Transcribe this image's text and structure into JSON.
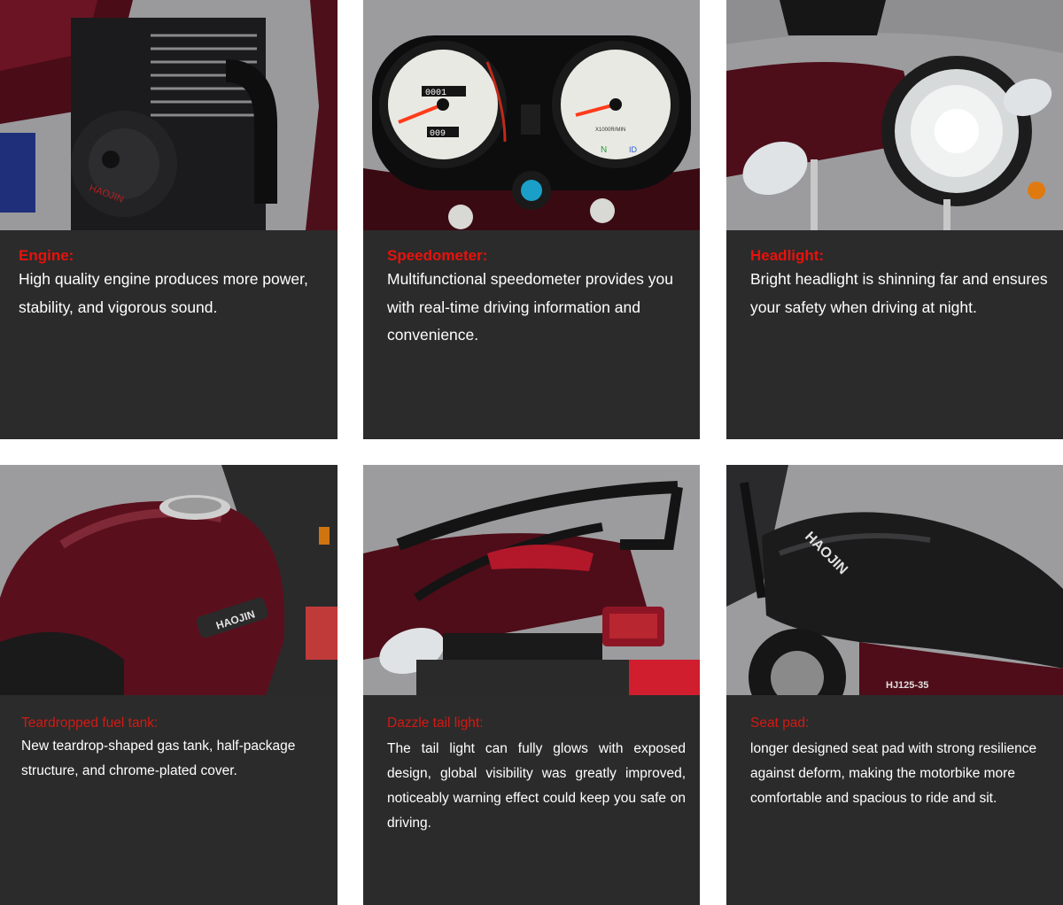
{
  "features": [
    {
      "id": "engine",
      "title": "Engine:",
      "description": "High quality engine produces more power, stability, and vigorous sound.",
      "photo_logo_text": "HAOJIN"
    },
    {
      "id": "speedometer",
      "title": "Speedometer:",
      "description": "Multifunctional speedometer provides you with real-time driving information and convenience.",
      "odometer": "0001",
      "tripmeter": "009",
      "rpm_label": "X1000R/MIN",
      "gear_indicator": "N",
      "beam_indicator": "ID"
    },
    {
      "id": "headlight",
      "title": "Headlight:",
      "description": "Bright headlight is shinning far and ensures your safety when driving at night."
    },
    {
      "id": "fuel-tank",
      "title": "Teardropped fuel tank:",
      "description": "New teardrop-shaped gas tank, half-package structure, and chrome-plated cover.",
      "badge_text": "HAOJIN"
    },
    {
      "id": "tail-light",
      "title": "Dazzle tail light:",
      "description": "The tail light can fully glows with exposed design, global visibility was greatly improved, noticeably warning effect could keep you safe on driving."
    },
    {
      "id": "seat-pad",
      "title": "Seat pad:",
      "description": "longer designed seat pad  with strong resilience against deform, making the motorbike  more comfortable and spacious to ride and sit.",
      "seat_text": "HAOJIN",
      "model_text": "HJ125-35"
    }
  ],
  "colors": {
    "card_bg": "#2b2b2b",
    "title_red": "#e8120c",
    "paint_maroon": "#5a0f1c",
    "photo_gray": "#9b9b9b"
  }
}
